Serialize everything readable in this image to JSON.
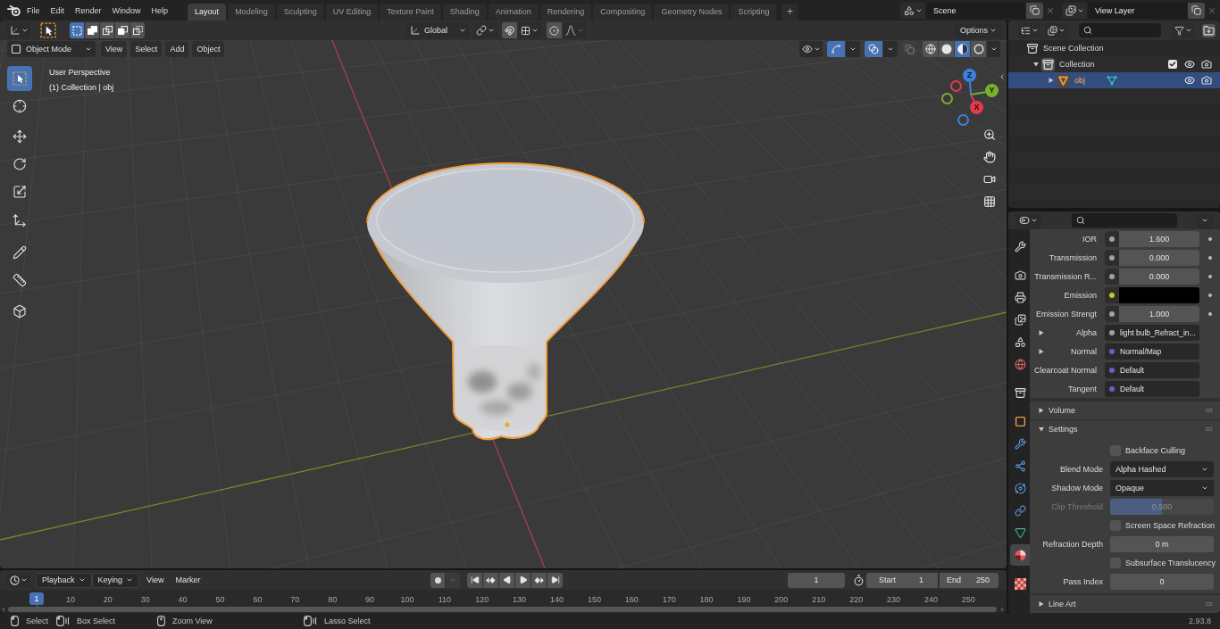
{
  "top_bar": {
    "menus": [
      "File",
      "Edit",
      "Render",
      "Window",
      "Help"
    ],
    "workspaces": [
      {
        "label": "Layout",
        "selected": true
      },
      {
        "label": "Modeling",
        "selected": false
      },
      {
        "label": "Sculpting",
        "selected": false
      },
      {
        "label": "UV Editing",
        "selected": false
      },
      {
        "label": "Texture Paint",
        "selected": false
      },
      {
        "label": "Shading",
        "selected": false
      },
      {
        "label": "Animation",
        "selected": false
      },
      {
        "label": "Rendering",
        "selected": false
      },
      {
        "label": "Compositing",
        "selected": false
      },
      {
        "label": "Geometry Nodes",
        "selected": false
      },
      {
        "label": "Scripting",
        "selected": false
      }
    ],
    "add_workspace": "+",
    "scene": "Scene",
    "view_layer": "View Layer"
  },
  "viewport": {
    "tool_header": {
      "select_modes": [
        {
          "selected": true
        },
        {
          "selected": false
        },
        {
          "selected": false
        },
        {
          "selected": false
        },
        {
          "selected": false
        }
      ],
      "orientation": "Global",
      "snap": false,
      "proportional_editing": false,
      "options": "Options"
    },
    "header": {
      "mode": "Object Mode",
      "menus": [
        "View",
        "Select",
        "Add",
        "Object"
      ],
      "gizmos": true,
      "overlays": true,
      "xray": false,
      "shading_modes": [
        {
          "selected": false
        },
        {
          "selected": false
        },
        {
          "selected": true
        },
        {
          "selected": false
        }
      ]
    },
    "info": [
      "User Perspective",
      "(1) Collection | obj"
    ],
    "tools": [
      {
        "selected": true
      },
      {
        "selected": false
      },
      {
        "selected": false
      },
      {
        "selected": false
      },
      {
        "selected": false
      },
      {
        "selected": false
      },
      {
        "selected": false
      },
      {
        "selected": false
      },
      {
        "selected": false
      }
    ],
    "nav_gizmo": [
      {
        "label": "Z",
        "color": "#3b82e0"
      },
      {
        "label": "Y",
        "color": "#7ab02c"
      },
      {
        "label": "X",
        "color": "#e8374f"
      }
    ]
  },
  "outliner": {
    "tree": [
      {
        "kind": "scene_collection",
        "label": "Scene Collection",
        "selected": false,
        "children": [
          {
            "kind": "collection",
            "label": "Collection",
            "selected": false,
            "expanded": true,
            "checked": true,
            "children": [
              {
                "kind": "object",
                "label": "obj",
                "selected": true,
                "expanded": false
              }
            ]
          }
        ]
      }
    ]
  },
  "properties": {
    "tabs": [
      {
        "selected": false
      },
      {
        "selected": false
      },
      {
        "selected": false
      },
      {
        "selected": false
      },
      {
        "selected": false
      },
      {
        "selected": false
      },
      {
        "selected": false
      },
      {
        "selected": false
      },
      {
        "selected": false
      },
      {
        "selected": false
      },
      {
        "selected": false
      },
      {
        "selected": false
      },
      {
        "selected": false
      },
      {
        "selected": true
      },
      {
        "selected": false
      }
    ],
    "inputs": [
      {
        "kind": "value",
        "label": "IOR",
        "value": "1.600",
        "color": "#a1a1a1"
      },
      {
        "kind": "value",
        "label": "Transmission",
        "value": "0.000",
        "color": "#a1a1a1"
      },
      {
        "kind": "value",
        "label": "Transmission R...",
        "value": "0.000",
        "color": "#a1a1a1"
      },
      {
        "kind": "color",
        "label": "Emission",
        "color": "#c7c729"
      },
      {
        "kind": "value",
        "label": "Emission Strengt",
        "value": "1.000",
        "color": "#a1a1a1"
      },
      {
        "kind": "link",
        "label": "Alpha",
        "value": "light bulb_Refract_in...",
        "expanded": false,
        "color": "#a1a1a1"
      },
      {
        "kind": "link",
        "label": "Normal",
        "value": "Normal/Map",
        "expanded": false,
        "color": "#6363c7"
      },
      {
        "kind": "link",
        "label": "Clearcoat Normal",
        "value": "Default",
        "color": "#6363c7"
      },
      {
        "kind": "link",
        "label": "Tangent",
        "value": "Default",
        "color": "#6363c7"
      }
    ],
    "sections": [
      {
        "label": "Volume",
        "expanded": false
      },
      {
        "label": "Settings",
        "expanded": true,
        "children": [
          {
            "kind": "checkbox",
            "label": "Backface Culling",
            "checked": false
          },
          {
            "kind": "dropdown",
            "label": "Blend Mode",
            "value": "Alpha Hashed"
          },
          {
            "kind": "dropdown",
            "label": "Shadow Mode",
            "value": "Opaque"
          },
          {
            "kind": "slider",
            "label": "Clip Threshold",
            "value": "0.500",
            "level": 0.5,
            "disabled": true
          },
          {
            "kind": "checkbox",
            "label": "Screen Space Refraction",
            "checked": false
          },
          {
            "kind": "field",
            "label": "Refraction Depth",
            "value": "0 m"
          },
          {
            "kind": "checkbox",
            "label": "Subsurface Translucency",
            "checked": false
          },
          {
            "kind": "field",
            "label": "Pass Index",
            "value": "0"
          }
        ]
      },
      {
        "label": "Line Art",
        "expanded": false
      }
    ]
  },
  "timeline": {
    "menus": [
      {
        "label": "Playback",
        "dropdown": true
      },
      {
        "label": "Keying",
        "dropdown": true
      },
      {
        "label": "View",
        "dropdown": false
      },
      {
        "label": "Marker",
        "dropdown": false
      }
    ],
    "auto_keying": false,
    "current_frame": "1",
    "start": {
      "label": "Start",
      "value": "1"
    },
    "end": {
      "label": "End",
      "value": "250"
    },
    "playhead": "1",
    "ruler": [
      "10",
      "20",
      "30",
      "40",
      "50",
      "60",
      "70",
      "80",
      "90",
      "100",
      "110",
      "120",
      "130",
      "140",
      "150",
      "160",
      "170",
      "180",
      "190",
      "200",
      "210",
      "220",
      "230",
      "240",
      "250"
    ]
  },
  "status_bar": {
    "hints": [
      "Select",
      "Box Select",
      "Zoom View",
      "Lasso Select"
    ],
    "version": "2.93.8"
  }
}
